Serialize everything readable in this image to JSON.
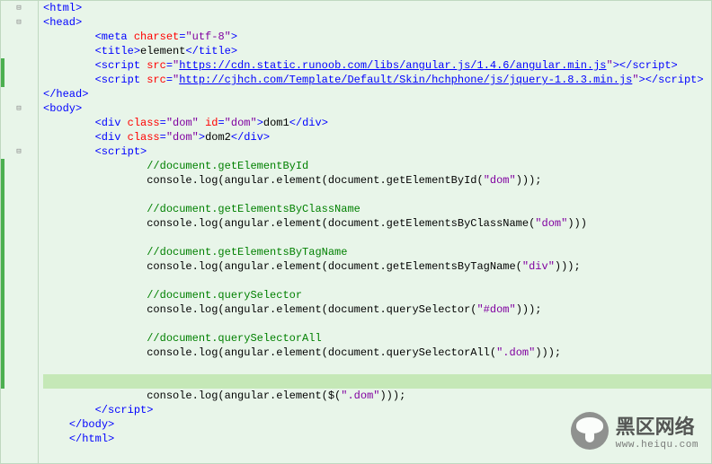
{
  "watermark": {
    "cn": "黑区网络",
    "en": "www.heiqu.com"
  },
  "code": {
    "lines": [
      {
        "indent": 0,
        "type": "tag-open",
        "el": "html",
        "fold": "⊟"
      },
      {
        "indent": 0,
        "type": "tag-open",
        "el": "head",
        "fold": "⊟"
      },
      {
        "indent": 2,
        "type": "meta",
        "attr": "charset",
        "val": "utf-8"
      },
      {
        "indent": 2,
        "type": "title",
        "text": "element"
      },
      {
        "indent": 2,
        "type": "script-src",
        "url": "https://cdn.static.runoob.com/libs/angular.js/1.4.6/angular.min.js"
      },
      {
        "indent": 2,
        "type": "script-src",
        "url": "http://cjhch.com/Template/Default/Skin/hchphone/js/jquery-1.8.3.min.js"
      },
      {
        "indent": 0,
        "type": "tag-close",
        "el": "head"
      },
      {
        "indent": 0,
        "type": "tag-open",
        "el": "body",
        "fold": "⊟"
      },
      {
        "indent": 2,
        "type": "div",
        "attrs": [
          [
            "class",
            "dom"
          ],
          [
            "id",
            "dom"
          ]
        ],
        "text": "dom1"
      },
      {
        "indent": 2,
        "type": "div",
        "attrs": [
          [
            "class",
            "dom"
          ]
        ],
        "text": "dom2"
      },
      {
        "indent": 2,
        "type": "tag-open",
        "el": "script",
        "fold": "⊟"
      },
      {
        "indent": 4,
        "type": "comment",
        "text": "//document.getElementById"
      },
      {
        "indent": 4,
        "type": "code",
        "pre": "console.log(angular.element(document.getElementById(",
        "str": "\"dom\"",
        "post": ")));"
      },
      {
        "indent": 4,
        "type": "blank"
      },
      {
        "indent": 4,
        "type": "comment",
        "text": "//document.getElementsByClassName"
      },
      {
        "indent": 4,
        "type": "code",
        "pre": "console.log(angular.element(document.getElementsByClassName(",
        "str": "\"dom\"",
        "post": ")))"
      },
      {
        "indent": 4,
        "type": "blank"
      },
      {
        "indent": 4,
        "type": "comment",
        "text": "//document.getElementsByTagName"
      },
      {
        "indent": 4,
        "type": "code",
        "pre": "console.log(angular.element(document.getElementsByTagName(",
        "str": "\"div\"",
        "post": ")));"
      },
      {
        "indent": 4,
        "type": "blank"
      },
      {
        "indent": 4,
        "type": "comment",
        "text": "//document.querySelector"
      },
      {
        "indent": 4,
        "type": "code",
        "pre": "console.log(angular.element(document.querySelector(",
        "str": "\"#dom\"",
        "post": ")));"
      },
      {
        "indent": 4,
        "type": "blank"
      },
      {
        "indent": 4,
        "type": "comment",
        "text": "//document.querySelectorAll"
      },
      {
        "indent": 4,
        "type": "code",
        "pre": "console.log(angular.element(document.querySelectorAll(",
        "str": "\".dom\"",
        "post": ")));"
      },
      {
        "indent": 4,
        "type": "blank"
      },
      {
        "indent": 4,
        "type": "blank",
        "highlight": true
      },
      {
        "indent": 4,
        "type": "code",
        "pre": "console.log(angular.element($(",
        "str": "\".dom\"",
        "post": ")));"
      },
      {
        "indent": 2,
        "type": "tag-close",
        "el": "script"
      },
      {
        "indent": 1,
        "type": "tag-close",
        "el": "body"
      },
      {
        "indent": 1,
        "type": "tag-close",
        "el": "html"
      }
    ]
  }
}
